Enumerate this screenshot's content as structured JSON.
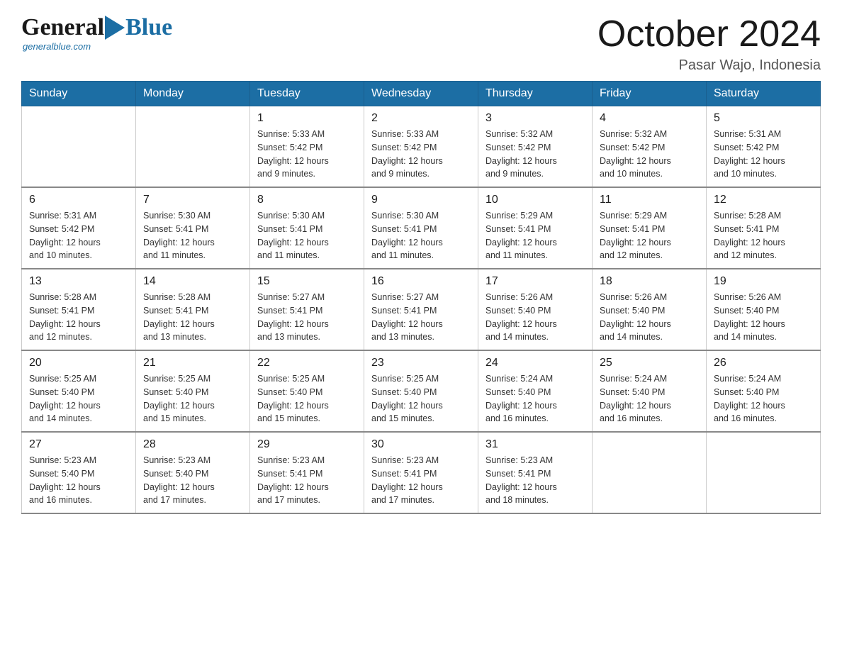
{
  "logo": {
    "general": "General",
    "blue": "Blue",
    "tagline": "generalblue.com"
  },
  "title": "October 2024",
  "subtitle": "Pasar Wajo, Indonesia",
  "weekdays": [
    "Sunday",
    "Monday",
    "Tuesday",
    "Wednesday",
    "Thursday",
    "Friday",
    "Saturday"
  ],
  "weeks": [
    [
      {
        "day": "",
        "info": ""
      },
      {
        "day": "",
        "info": ""
      },
      {
        "day": "1",
        "info": "Sunrise: 5:33 AM\nSunset: 5:42 PM\nDaylight: 12 hours\nand 9 minutes."
      },
      {
        "day": "2",
        "info": "Sunrise: 5:33 AM\nSunset: 5:42 PM\nDaylight: 12 hours\nand 9 minutes."
      },
      {
        "day": "3",
        "info": "Sunrise: 5:32 AM\nSunset: 5:42 PM\nDaylight: 12 hours\nand 9 minutes."
      },
      {
        "day": "4",
        "info": "Sunrise: 5:32 AM\nSunset: 5:42 PM\nDaylight: 12 hours\nand 10 minutes."
      },
      {
        "day": "5",
        "info": "Sunrise: 5:31 AM\nSunset: 5:42 PM\nDaylight: 12 hours\nand 10 minutes."
      }
    ],
    [
      {
        "day": "6",
        "info": "Sunrise: 5:31 AM\nSunset: 5:42 PM\nDaylight: 12 hours\nand 10 minutes."
      },
      {
        "day": "7",
        "info": "Sunrise: 5:30 AM\nSunset: 5:41 PM\nDaylight: 12 hours\nand 11 minutes."
      },
      {
        "day": "8",
        "info": "Sunrise: 5:30 AM\nSunset: 5:41 PM\nDaylight: 12 hours\nand 11 minutes."
      },
      {
        "day": "9",
        "info": "Sunrise: 5:30 AM\nSunset: 5:41 PM\nDaylight: 12 hours\nand 11 minutes."
      },
      {
        "day": "10",
        "info": "Sunrise: 5:29 AM\nSunset: 5:41 PM\nDaylight: 12 hours\nand 11 minutes."
      },
      {
        "day": "11",
        "info": "Sunrise: 5:29 AM\nSunset: 5:41 PM\nDaylight: 12 hours\nand 12 minutes."
      },
      {
        "day": "12",
        "info": "Sunrise: 5:28 AM\nSunset: 5:41 PM\nDaylight: 12 hours\nand 12 minutes."
      }
    ],
    [
      {
        "day": "13",
        "info": "Sunrise: 5:28 AM\nSunset: 5:41 PM\nDaylight: 12 hours\nand 12 minutes."
      },
      {
        "day": "14",
        "info": "Sunrise: 5:28 AM\nSunset: 5:41 PM\nDaylight: 12 hours\nand 13 minutes."
      },
      {
        "day": "15",
        "info": "Sunrise: 5:27 AM\nSunset: 5:41 PM\nDaylight: 12 hours\nand 13 minutes."
      },
      {
        "day": "16",
        "info": "Sunrise: 5:27 AM\nSunset: 5:41 PM\nDaylight: 12 hours\nand 13 minutes."
      },
      {
        "day": "17",
        "info": "Sunrise: 5:26 AM\nSunset: 5:40 PM\nDaylight: 12 hours\nand 14 minutes."
      },
      {
        "day": "18",
        "info": "Sunrise: 5:26 AM\nSunset: 5:40 PM\nDaylight: 12 hours\nand 14 minutes."
      },
      {
        "day": "19",
        "info": "Sunrise: 5:26 AM\nSunset: 5:40 PM\nDaylight: 12 hours\nand 14 minutes."
      }
    ],
    [
      {
        "day": "20",
        "info": "Sunrise: 5:25 AM\nSunset: 5:40 PM\nDaylight: 12 hours\nand 14 minutes."
      },
      {
        "day": "21",
        "info": "Sunrise: 5:25 AM\nSunset: 5:40 PM\nDaylight: 12 hours\nand 15 minutes."
      },
      {
        "day": "22",
        "info": "Sunrise: 5:25 AM\nSunset: 5:40 PM\nDaylight: 12 hours\nand 15 minutes."
      },
      {
        "day": "23",
        "info": "Sunrise: 5:25 AM\nSunset: 5:40 PM\nDaylight: 12 hours\nand 15 minutes."
      },
      {
        "day": "24",
        "info": "Sunrise: 5:24 AM\nSunset: 5:40 PM\nDaylight: 12 hours\nand 16 minutes."
      },
      {
        "day": "25",
        "info": "Sunrise: 5:24 AM\nSunset: 5:40 PM\nDaylight: 12 hours\nand 16 minutes."
      },
      {
        "day": "26",
        "info": "Sunrise: 5:24 AM\nSunset: 5:40 PM\nDaylight: 12 hours\nand 16 minutes."
      }
    ],
    [
      {
        "day": "27",
        "info": "Sunrise: 5:23 AM\nSunset: 5:40 PM\nDaylight: 12 hours\nand 16 minutes."
      },
      {
        "day": "28",
        "info": "Sunrise: 5:23 AM\nSunset: 5:40 PM\nDaylight: 12 hours\nand 17 minutes."
      },
      {
        "day": "29",
        "info": "Sunrise: 5:23 AM\nSunset: 5:41 PM\nDaylight: 12 hours\nand 17 minutes."
      },
      {
        "day": "30",
        "info": "Sunrise: 5:23 AM\nSunset: 5:41 PM\nDaylight: 12 hours\nand 17 minutes."
      },
      {
        "day": "31",
        "info": "Sunrise: 5:23 AM\nSunset: 5:41 PM\nDaylight: 12 hours\nand 18 minutes."
      },
      {
        "day": "",
        "info": ""
      },
      {
        "day": "",
        "info": ""
      }
    ]
  ]
}
